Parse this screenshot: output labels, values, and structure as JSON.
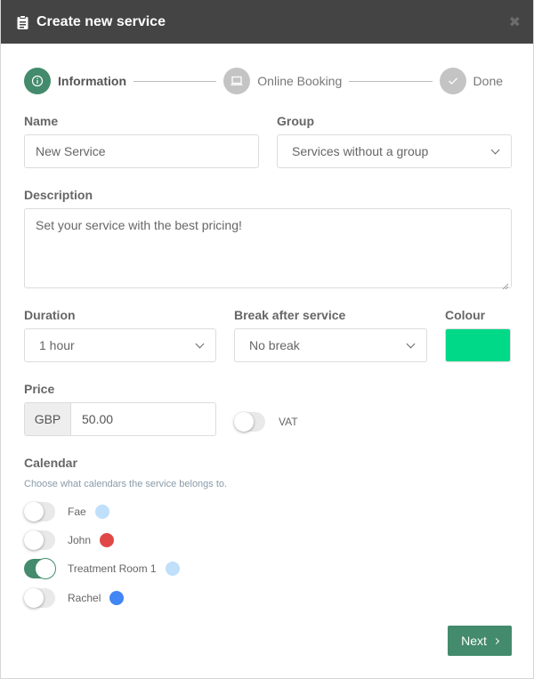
{
  "header": {
    "title": "Create new service",
    "icon": "clipboard-icon",
    "close_icon": "close-icon"
  },
  "stepper": {
    "steps": [
      {
        "label": "Information",
        "icon": "info-icon",
        "state": "active"
      },
      {
        "label": "Online Booking",
        "icon": "laptop-icon",
        "state": "inactive"
      },
      {
        "label": "Done",
        "icon": "check-icon",
        "state": "inactive"
      }
    ]
  },
  "form": {
    "name": {
      "label": "Name",
      "value": "New Service"
    },
    "group": {
      "label": "Group",
      "value": "Services without a group"
    },
    "description": {
      "label": "Description",
      "value": "Set your service with the best pricing!"
    },
    "duration": {
      "label": "Duration",
      "value": "1 hour"
    },
    "break_after": {
      "label": "Break after service",
      "value": "No break"
    },
    "colour": {
      "label": "Colour",
      "value": "#00d987"
    },
    "price": {
      "label": "Price",
      "currency": "GBP",
      "value": "50.00"
    },
    "vat": {
      "label": "VAT",
      "enabled": false
    }
  },
  "calendar": {
    "label": "Calendar",
    "hint": "Choose what calendars the service belongs to.",
    "items": [
      {
        "name": "Fae",
        "color": "#bfdffb",
        "enabled": false
      },
      {
        "name": "John",
        "color": "#e04848",
        "enabled": false
      },
      {
        "name": "Treatment Room 1",
        "color": "#bfdffb",
        "enabled": true
      },
      {
        "name": "Rachel",
        "color": "#4285f4",
        "enabled": false
      }
    ]
  },
  "footer": {
    "next_label": "Next"
  },
  "colors": {
    "accent": "#438b6c",
    "header_bg": "#444444"
  }
}
